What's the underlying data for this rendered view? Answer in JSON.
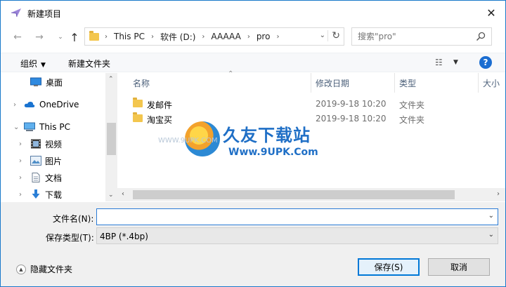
{
  "window": {
    "title": "新建项目"
  },
  "nav": {
    "back_icon": "arrow-left-icon",
    "forward_icon": "arrow-right-icon",
    "up_icon": "arrow-up-icon",
    "breadcrumbs": [
      "This PC",
      "软件 (D:)",
      "AAAAA",
      "pro"
    ],
    "search_placeholder": "搜索\"pro\""
  },
  "toolbar": {
    "organize_label": "组织",
    "new_folder_label": "新建文件夹",
    "help_label": "?"
  },
  "sidebar": {
    "items": [
      {
        "label": "桌面",
        "icon": "desktop-icon"
      },
      {
        "label": "OneDrive",
        "icon": "cloud-icon"
      },
      {
        "label": "This PC",
        "icon": "computer-icon"
      },
      {
        "label": "视频",
        "icon": "video-icon"
      },
      {
        "label": "图片",
        "icon": "picture-icon"
      },
      {
        "label": "文档",
        "icon": "document-icon"
      },
      {
        "label": "下载",
        "icon": "download-icon"
      }
    ]
  },
  "files": {
    "columns": [
      "名称",
      "修改日期",
      "类型",
      "大小"
    ],
    "rows": [
      {
        "name": "发邮件",
        "date": "2019-9-18 10:20",
        "type": "文件夹"
      },
      {
        "name": "淘宝买",
        "date": "2019-9-18 10:20",
        "type": "文件夹"
      }
    ]
  },
  "watermark": {
    "title": "久友下载站",
    "url": "Www.9UPK.Com",
    "small": "WWW.9UPK.COM"
  },
  "form": {
    "filename_label": "文件名(N):",
    "filename_value": "",
    "filetype_label": "保存类型(T):",
    "filetype_value": "4BP (*.4bp)",
    "hide_folders_label": "隐藏文件夹",
    "save_label": "保存(S)",
    "cancel_label": "取消"
  },
  "colors": {
    "accent": "#0078d7",
    "folder": "#f3c64e",
    "help": "#1a6dd1"
  }
}
